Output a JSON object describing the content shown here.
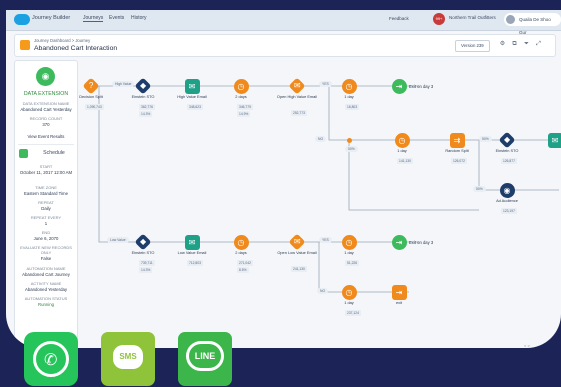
{
  "header": {
    "app_name": "Journey Builder",
    "tabs": [
      "Journeys",
      "Events",
      "History"
    ],
    "feedback": "Feedback",
    "notification_count": "99+",
    "account": "Northern Trail Outfitters",
    "user": "Quaila De Shoo Gur"
  },
  "subheader": {
    "breadcrumb": "Journey Dashboard > Journey",
    "title": "Abandoned Cart Interaction",
    "version": "Version 239"
  },
  "left_panel": {
    "entry_title": "DATA EXTENSION",
    "de_name_label": "DATA EXTENSION NAME",
    "de_name": "Abandoned Cart Yesterday",
    "record_count_label": "RECORD COUNT",
    "record_count": "370",
    "view_event_results": "View Event Results",
    "schedule_title": "Schedule",
    "start_label": "START",
    "start": "October 11, 2017 12:00 AM",
    "timezone_label": "TIME ZONE",
    "timezone": "Eastern Standard Time",
    "repeat_label": "REPEAT",
    "repeat": "Daily",
    "repeat_every_label": "REPEAT EVERY",
    "repeat_every": "1",
    "end_label": "END",
    "end": "June 6, 2070",
    "evaluate_label": "EVALUATE NEW RECORDS ONLY",
    "evaluate": "False",
    "automation_name_label": "AUTOMATION NAME",
    "automation_name": "Abandoned Cart Journey",
    "activity_name_label": "ACTIVITY NAME",
    "activity_name": "Abandoned Yesterday",
    "automation_status_label": "AUTOMATION STATUS",
    "automation_status": "Running"
  },
  "canvas": {
    "decision_split": "Decision Split",
    "high_value": "High Value",
    "low_value": "Low Value",
    "einstein_sto": "Einstein STO",
    "high_value_email": "High Value Email",
    "low_value_email": "Low Value Email",
    "two_days": "2 days",
    "open_high_value": "Open High Value Email",
    "open_low_value": "Open Low Value Email",
    "one_day": "1 day",
    "exit_on_day": "Exit on day 3",
    "random_split": "Random Split",
    "einstein_sto_b": "Einstein STO",
    "ad_audience": "Ad Audience",
    "exit": "exit",
    "yes": "YES",
    "no": "NO",
    "pct_50": "50%",
    "stats": {
      "ds": "1,090,743",
      "sto1": "362,776",
      "sto1b": "14.3%",
      "hve": "348,623",
      "d2": "346,779",
      "d2b": "14.9%",
      "ohv": "252,773",
      "oh1": "16,803",
      "r1": "141,130",
      "rs": "126,072",
      "sto2": "126,877",
      "ad": "123,197",
      "sto3": "739,711",
      "sto3b": "14.3%",
      "lve": "712,803",
      "d2l": "271,042",
      "d2lb": "8.5%",
      "olv": "241,130",
      "ol1": "51,226",
      "ol2": "237,124"
    },
    "pager": "< >"
  },
  "badges": {
    "sms_label": "SMS",
    "line_label": "LINE"
  },
  "colors": {
    "accent": "#f08a1c",
    "navy": "#1f3d6b",
    "teal": "#1fa187",
    "green": "#3dbb5c",
    "background": "#1b2357"
  }
}
